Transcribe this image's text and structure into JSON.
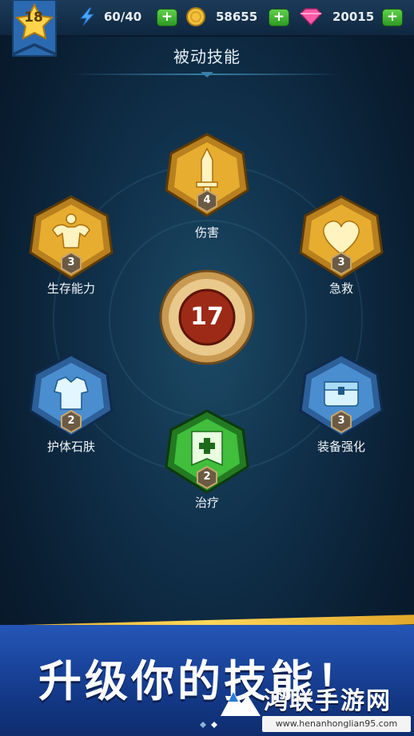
{
  "header": {
    "player_level": "18",
    "energy": "60/40",
    "coins": "58655",
    "gems": "20015",
    "add_label": "+"
  },
  "section_title": "被动技能",
  "skill_points": "17",
  "skills": [
    {
      "name": "伤害",
      "level": "4",
      "icon": "sword-icon",
      "tier": "gold"
    },
    {
      "name": "急救",
      "level": "3",
      "icon": "heart-icon",
      "tier": "gold"
    },
    {
      "name": "装备强化",
      "level": "3",
      "icon": "chest-icon",
      "tier": "blue"
    },
    {
      "name": "治疗",
      "level": "2",
      "icon": "medical-banner-icon",
      "tier": "green"
    },
    {
      "name": "护体石肤",
      "level": "2",
      "icon": "armor-icon",
      "tier": "blue"
    },
    {
      "name": "生存能力",
      "level": "3",
      "icon": "muscle-icon",
      "tier": "gold"
    }
  ],
  "banner": {
    "headline": "升级你的技能！"
  },
  "watermark": {
    "name": "鸿联手游网",
    "url": "www.henanhonglian95.com"
  },
  "colors": {
    "gold": "#e0a72a",
    "blue": "#3d86c8",
    "green": "#3bb23a",
    "banner": "#2456b8"
  }
}
